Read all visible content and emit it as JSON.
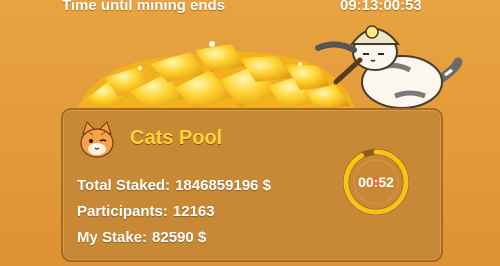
{
  "header": {
    "label": "Time until mining ends",
    "countdown": "09:13:00:53"
  },
  "pool": {
    "title": "Cats Pool",
    "stats": [
      {
        "label": "Total Staked:",
        "value": "1846859196 $"
      },
      {
        "label": "Participants:",
        "value": "12163"
      },
      {
        "label": "My Stake:",
        "value": "82590 $"
      }
    ],
    "round_timer": "00:52",
    "round_progress": 0.92
  },
  "colors": {
    "background": "#e39a38",
    "panel": "#c78935",
    "title": "#ffd23a",
    "ring": "#f7c21a"
  },
  "icons": [
    "cat-avatar-icon",
    "mining-cat-icon",
    "gold-pile-icon",
    "timer-ring-icon"
  ]
}
